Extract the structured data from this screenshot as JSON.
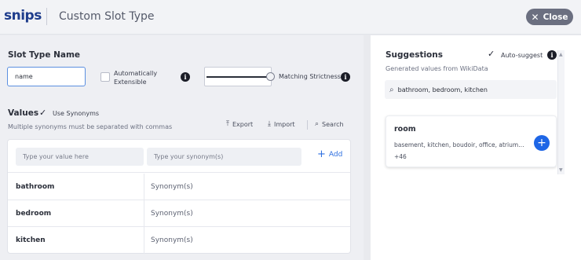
{
  "header": {
    "logo": "snips",
    "title": "Custom Slot Type",
    "close_label": "Close"
  },
  "slot_type": {
    "section_label": "Slot Type Name",
    "name_value": "name",
    "auto_extensible_line1": "Automatically",
    "auto_extensible_line2": "Extensible",
    "matching_strictness_label": "Matching Strictness",
    "matching_strictness_value": 1.0
  },
  "values": {
    "section_label": "Values",
    "use_synonyms_label": "Use Synonyms",
    "use_synonyms_checked": true,
    "hint": "Multiple synonyms must be separated with commas",
    "export_label": "Export",
    "import_label": "Import",
    "search_label": "Search",
    "value_placeholder": "Type your value here",
    "synonym_placeholder": "Type your synonym(s)",
    "add_label": "Add",
    "rows": [
      {
        "value": "bathroom",
        "synonyms": "Synonym(s)"
      },
      {
        "value": "bedroom",
        "synonyms": "Synonym(s)"
      },
      {
        "value": "kitchen",
        "synonyms": "Synonym(s)"
      }
    ]
  },
  "suggestions": {
    "title": "Suggestions",
    "auto_suggest_label": "Auto-suggest",
    "auto_suggest_checked": true,
    "source_text": "Generated values from WikiData",
    "search_value": "bathroom, bedroom, kitchen",
    "card": {
      "word": "room",
      "related": "basement, kitchen, boudoir, office, atrium…",
      "more": "+46"
    }
  },
  "colors": {
    "brand": "#1f3d8c",
    "accent": "#1e66e6",
    "close_button": "#6b6f80"
  }
}
